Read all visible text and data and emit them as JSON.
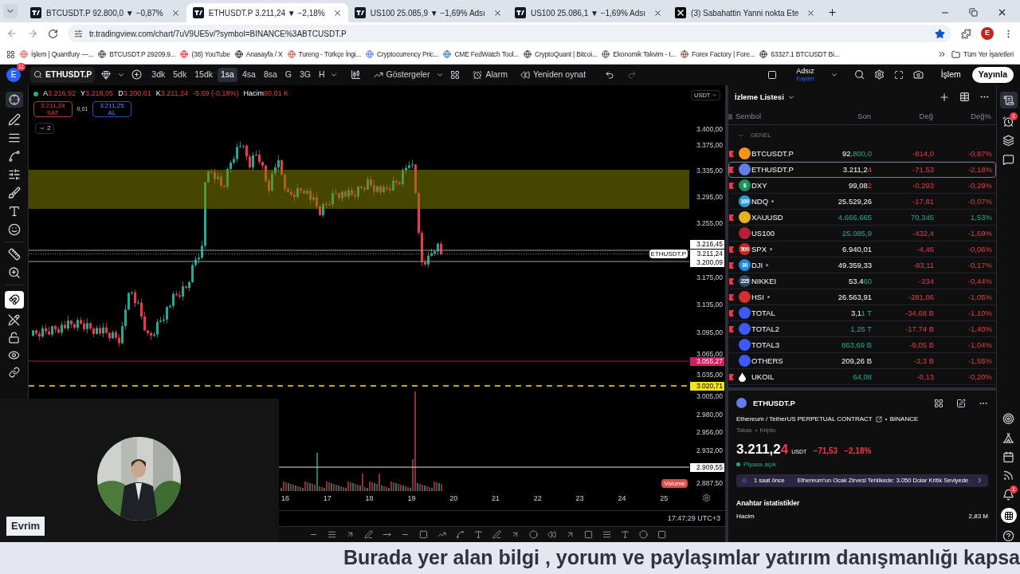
{
  "browser": {
    "tabs": [
      {
        "kind": "tradingview",
        "title": "BTCUSDT.P 92.800,0 ▼ −0,87%",
        "selected": false
      },
      {
        "kind": "tradingview",
        "title": "ETHUSDT.P 3.211,24 ▼ −2,18%",
        "selected": true
      },
      {
        "kind": "tradingview",
        "title": "US100 25.085,9 ▼ −1,69% Adsı",
        "selected": false
      },
      {
        "kind": "tradingview",
        "title": "US100 25.086,1 ▼ −1,69% Adsı",
        "selected": false
      },
      {
        "kind": "x",
        "title": "(3) Sabahattin Yanni nokta Ete",
        "selected": false
      }
    ],
    "url": "tr.tradingview.com/chart/7uV9UE5v/?symbol=BINANCE%3ABTCUSDT.P",
    "profile_initial": "E",
    "bookmarks": [
      "İşlem | Quantfury —...",
      "BTCUSDT.P 29209.9...",
      "(38) YouTube",
      "Anasayfa / X",
      "Tureng - Türkçe İngi...",
      "Cryptocurrency Pric...",
      "CME FedWatch Tool...",
      "CryptoQuant | Bitcoi...",
      "Ekonomik Takvim - I...",
      "Forex Factory | Fore...",
      "63327.1 BTCUSDT Bi..."
    ],
    "all_bookmarks": "Tüm Yer İşaretleri"
  },
  "toolbar": {
    "avatar": "E",
    "avatar_badge": "11",
    "symbol": "ETHUSDT.P",
    "intervals": [
      {
        "label": "3dk",
        "selected": false
      },
      {
        "label": "5dk",
        "selected": false
      },
      {
        "label": "15dk",
        "selected": false
      },
      {
        "label": "1sa",
        "selected": true
      },
      {
        "label": "4sa",
        "selected": false
      },
      {
        "label": "8sa",
        "selected": false
      },
      {
        "label": "G",
        "selected": false
      },
      {
        "label": "3G",
        "selected": false
      },
      {
        "label": "H",
        "selected": false
      }
    ],
    "indicators": "Göstergeler",
    "alarm": "Alarm",
    "replay": "Yeniden oynat",
    "layout_name": "Adsız",
    "layout_status": "Kaydet",
    "trade": "İşlem",
    "publish": "Yayınla"
  },
  "drawing_tools": {
    "magnet_on": true
  },
  "legend": {
    "rising": false,
    "ohlc": [
      {
        "key": "A",
        "value": "3.216,92"
      },
      {
        "key": "Y",
        "value": "3.218,05"
      },
      {
        "key": "D",
        "value": "3.200,01"
      },
      {
        "key": "K",
        "value": "3.211,24"
      }
    ],
    "change": "-5,69 (-0,18%)",
    "volume_label": "Hacim",
    "volume": "90,01 K",
    "sell_price": "3.211,24",
    "sell_label": "SAT",
    "spread": "0,01",
    "buy_price": "3.211,25",
    "buy_label": "AL",
    "collapsed_count": "2"
  },
  "price_axis": {
    "currency": "USDT",
    "ticks": [
      "3.400,00",
      "3.375,00",
      "3.335,00",
      "3.295,00",
      "3.255,00",
      "3.175,00",
      "3.135,00",
      "3.095,00",
      "3.065,00",
      "3.035,00",
      "3.005,00",
      "2.980,00",
      "2.956,00",
      "2.932,00",
      "2.887,50"
    ],
    "markers": [
      {
        "label": "3.216,45",
        "color": "#ffffff"
      },
      {
        "label": "3.211,24",
        "color": "#ffffff",
        "tag": "ETHUSDT.P"
      },
      {
        "label": "3.200,09",
        "color": "#ffffff"
      },
      {
        "label": "3.055,27",
        "color": "#d81b60"
      },
      {
        "label": "3.020,71",
        "color": "#f5e31a"
      },
      {
        "label": "2.909,55",
        "color": "#ffffff"
      }
    ],
    "volume_tag": "Volume"
  },
  "time_axis": {
    "dates": [
      "16",
      "17",
      "18",
      "19",
      "20",
      "21",
      "22",
      "23",
      "24",
      "25"
    ],
    "clock": "17:47:29 UTC+3"
  },
  "watchlist": {
    "title": "İzleme Listesi",
    "columns": [
      "Sembol",
      "Son",
      "Değ",
      "Değ%"
    ],
    "section": "GENEL",
    "rows": [
      {
        "kind": "coin",
        "symbol": "BTCUSDT.P",
        "color": "#f7931a",
        "flagged": true,
        "dot": false,
        "selected": false,
        "last_head": "92.",
        "last_tail": "800,0",
        "tail_rising": true,
        "change": "-814,0",
        "change_pct": "-0,87%",
        "rising": false
      },
      {
        "kind": "coin",
        "symbol": "ETHUSDT.P",
        "color": "#627eea",
        "flagged": true,
        "dot": false,
        "selected": true,
        "last_head": "3.211,2",
        "last_tail": "4",
        "tail_rising": false,
        "change": "-71,53",
        "change_pct": "-2,18%",
        "rising": false
      },
      {
        "kind": "coin",
        "symbol": "DXY",
        "color": "#1e8f5e",
        "badge": "$",
        "flagged": true,
        "dot": false,
        "selected": false,
        "last_head": "99,08",
        "last_tail": "2",
        "tail_rising": false,
        "change": "-0,293",
        "change_pct": "-0,29%",
        "rising": false
      },
      {
        "kind": "coin",
        "symbol": "NDQ",
        "color": "#2a9fd6",
        "badge": "100",
        "flagged": false,
        "dot": true,
        "selected": false,
        "last_head": "25.529,26",
        "change": "-17,81",
        "change_pct": "-0,07%",
        "rising": false
      },
      {
        "kind": "coin",
        "symbol": "XAUUSD",
        "color": "#e6b422",
        "flagged": true,
        "dot": false,
        "selected": false,
        "last_tail": "4.666,665",
        "tail_rising": true,
        "change": "70,345",
        "change_pct": "1,53%",
        "rising": true
      },
      {
        "kind": "coin",
        "symbol": "US100",
        "color": "#b22234",
        "flagged": false,
        "dot": false,
        "selected": false,
        "last_tail": "25.085,9",
        "tail_rising": true,
        "change": "-432,4",
        "change_pct": "-1,69%",
        "rising": false
      },
      {
        "kind": "coin",
        "symbol": "SPX",
        "color": "#c62828",
        "badge": "500",
        "flagged": true,
        "dot": true,
        "selected": false,
        "last_head": "6.940,01",
        "change": "-4,46",
        "change_pct": "-0,06%",
        "rising": false
      },
      {
        "kind": "coin",
        "symbol": "DJI",
        "color": "#1e88e5",
        "badge": "30",
        "flagged": true,
        "dot": true,
        "selected": false,
        "last_head": "49.359,33",
        "change": "-83,11",
        "change_pct": "-0,17%",
        "rising": false
      },
      {
        "kind": "coin",
        "symbol": "NIKKEI",
        "color": "#2d4a6b",
        "badge": "225",
        "flagged": true,
        "dot": false,
        "selected": false,
        "last_head": "53.4",
        "last_tail": "60",
        "tail_rising": true,
        "change": "-234",
        "change_pct": "-0,44%",
        "rising": false
      },
      {
        "kind": "coin",
        "symbol": "HSI",
        "color": "#d32f2f",
        "flagged": true,
        "dot": true,
        "selected": false,
        "last_head": "26.563,91",
        "change": "-281,06",
        "change_pct": "-1,05%",
        "rising": false
      },
      {
        "kind": "coin",
        "symbol": "TOTAL",
        "color": "#3d5afe",
        "flagged": true,
        "dot": false,
        "selected": false,
        "last_head": "3,1",
        "last_tail": "1 T",
        "tail_rising": true,
        "change": "-34,68 B",
        "change_pct": "-1,10%",
        "rising": false
      },
      {
        "kind": "coin",
        "symbol": "TOTAL2",
        "color": "#3d5afe",
        "flagged": true,
        "dot": false,
        "selected": false,
        "last_tail": "1,25 T",
        "tail_rising": true,
        "change": "-17,74 B",
        "change_pct": "-1,40%",
        "rising": false
      },
      {
        "kind": "coin",
        "symbol": "TOTAL3",
        "color": "#3d5afe",
        "flagged": false,
        "dot": false,
        "selected": false,
        "last_tail": "863,69 B",
        "tail_rising": true,
        "change": "-9,05 B",
        "change_pct": "-1,04%",
        "rising": false
      },
      {
        "kind": "coin",
        "symbol": "OTHERS",
        "color": "#3d5afe",
        "flagged": false,
        "dot": false,
        "selected": false,
        "last_head": "209,26 B",
        "change": "-3,3 B",
        "change_pct": "-1,55%",
        "rising": false
      },
      {
        "kind": "drop",
        "symbol": "UKOIL",
        "color": "#ffffff",
        "flagged": true,
        "dot": false,
        "selected": false,
        "last_tail": "64,08",
        "tail_rising": true,
        "change": "-0,13",
        "change_pct": "-0,20%",
        "rising": false
      }
    ]
  },
  "details": {
    "symbol": "ETHUSDT.P",
    "description": "Ethereum / TetherUS PERPETUAL CONTRACT",
    "exchange": "BINANCE",
    "meta": [
      "Takas",
      "Kripto"
    ],
    "price_head": "3.211,2",
    "price_tail": "4",
    "tail_rising": false,
    "currency": "USDT",
    "change": "−71,53",
    "change_pct": "−2,18%",
    "rising": false,
    "market_open": true,
    "market_status": "Piyasa açık",
    "news": {
      "time": "1 saat önce",
      "headline": "Ethereum'un Ocak Zirvesi Tehlikede: 3.050 Dolar Kritik Seviyede"
    },
    "stats_title": "Anahtar istatistikler",
    "stats": [
      {
        "label": "Hacim",
        "value": "2,83 M"
      }
    ]
  },
  "side_bar": {
    "watchlist_open": true,
    "alarm_badge": "1",
    "notification_badge": "1"
  },
  "webcam": {
    "name": "Evrim"
  },
  "ticker": "Burada yer alan bilgi , yorum ve paylaşımlar yatırım danışmanlığı kapsa"
}
